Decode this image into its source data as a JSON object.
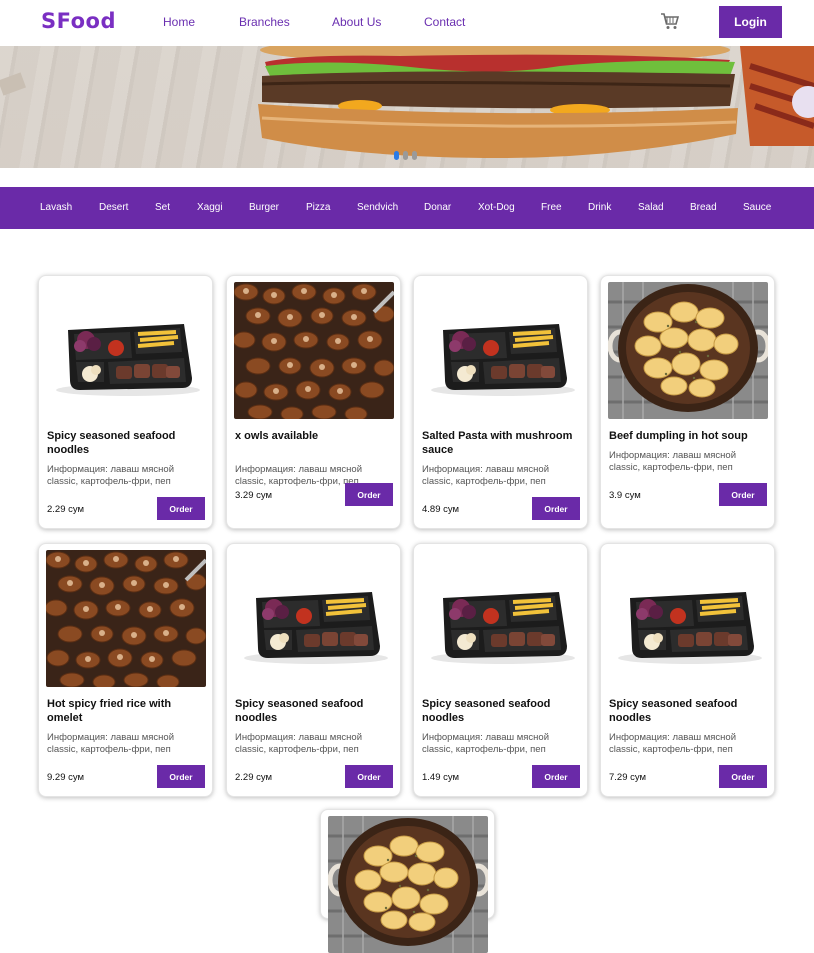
{
  "brand": {
    "logo": "SFood",
    "accent": "#6a2aa8"
  },
  "nav": {
    "links": [
      "Home",
      "Branches",
      "About Us",
      "Contact"
    ],
    "cart_icon": "cart-icon",
    "login_label": "Login"
  },
  "hero": {
    "slides_total": 3,
    "active_slide": 1
  },
  "categories": [
    "Lavash",
    "Desert",
    "Set",
    "Xaggi",
    "Burger",
    "Pizza",
    "Sendvich",
    "Donar",
    "Xot-Dog",
    "Free",
    "Drink",
    "Salad",
    "Bread",
    "Sauce"
  ],
  "products": [
    {
      "title": "Spicy seasoned seafood noodles",
      "info": "Информация: лаваш мясной classic, картофель-фри, пеп",
      "price": "2.29 сум",
      "order_label": "Order",
      "image": "lunchbox"
    },
    {
      "title": "x owls available",
      "info": "Информация: лаваш мясной classic, картофель-фри, пеп",
      "price": "3.29 сум",
      "order_label": "Order",
      "image": "mushrooms"
    },
    {
      "title": "Salted Pasta with mushroom sauce",
      "info": "Информация: лаваш мясной classic, картофель-фри, пеп",
      "price": "4.89 сум",
      "order_label": "Order",
      "image": "lunchbox"
    },
    {
      "title": "Beef dumpling in hot soup",
      "info": "Информация: лаваш мясной classic, картофель-фри, пеп",
      "price": "3.9 сум",
      "order_label": "Order",
      "image": "potatoes"
    },
    {
      "title": "Hot spicy fried rice with omelet",
      "info": "Информация: лаваш мясной classic, картофель-фри, пеп",
      "price": "9.29 сум",
      "order_label": "Order",
      "image": "mushrooms"
    },
    {
      "title": "Spicy seasoned seafood noodles",
      "info": "Информация: лаваш мясной classic, картофель-фри, пеп",
      "price": "2.29 сум",
      "order_label": "Order",
      "image": "lunchbox"
    },
    {
      "title": "Spicy seasoned seafood noodles",
      "info": "Информация: лаваш мясной classic, картофель-фри, пеп",
      "price": "1.49 сум",
      "order_label": "Order",
      "image": "lunchbox"
    },
    {
      "title": "Spicy seasoned seafood noodles",
      "info": "Информация: лаваш мясной classic, картофель-фри, пеп",
      "price": "7.29 сум",
      "order_label": "Order",
      "image": "lunchbox"
    },
    {
      "title": "",
      "info": "",
      "price": "",
      "order_label": "",
      "image": "potatoes"
    }
  ]
}
